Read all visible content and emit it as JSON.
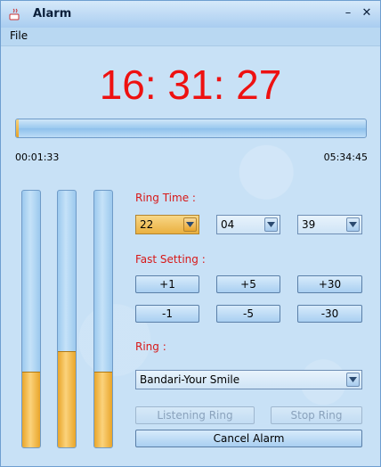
{
  "window": {
    "title": "Alarm",
    "minimize_glyph": "–",
    "close_glyph": "✕"
  },
  "menu": {
    "file": "File"
  },
  "clock": {
    "display": "16: 31: 27"
  },
  "elapsed": {
    "start": "00:01:33",
    "end": "05:34:45",
    "progress_fraction": 0.004
  },
  "level_bars": [
    0.29,
    0.37,
    0.29
  ],
  "ring_time": {
    "label": "Ring Time :",
    "hour": "22",
    "minute": "04",
    "second": "39"
  },
  "fast_setting": {
    "label": "Fast Setting :",
    "buttons": [
      "+1",
      "+5",
      "+30",
      "-1",
      "-5",
      "-30"
    ]
  },
  "ring": {
    "label": "Ring :",
    "selected": "Bandari-Your Smile"
  },
  "actions": {
    "listening": "Listening Ring",
    "stop": "Stop Ring",
    "cancel": "Cancel Alarm"
  },
  "colors": {
    "clock": "#ee1111",
    "label": "#d81818",
    "accent": "#e9a52a"
  }
}
